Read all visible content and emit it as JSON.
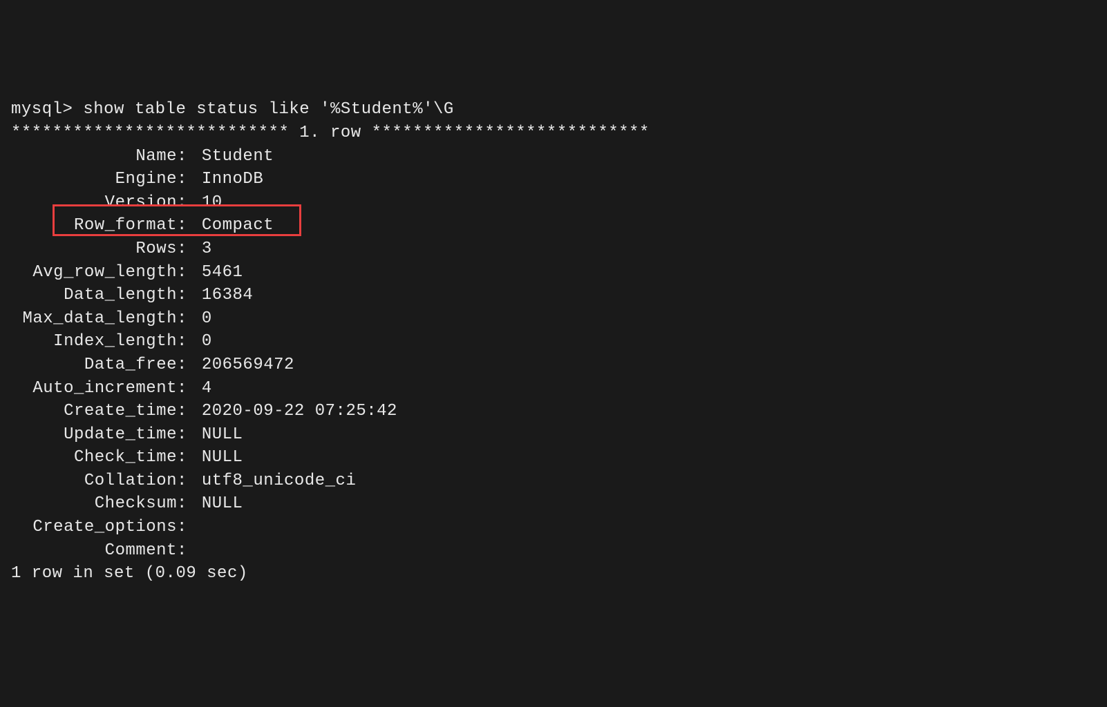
{
  "prompt": "mysql> ",
  "command": "show table status like '%Student%'\\G",
  "header": "*************************** 1. row ***************************",
  "fields": [
    {
      "key": "Name",
      "value": "Student"
    },
    {
      "key": "Engine",
      "value": "InnoDB"
    },
    {
      "key": "Version",
      "value": "10"
    },
    {
      "key": "Row_format",
      "value": "Compact"
    },
    {
      "key": "Rows",
      "value": "3"
    },
    {
      "key": "Avg_row_length",
      "value": "5461"
    },
    {
      "key": "Data_length",
      "value": "16384"
    },
    {
      "key": "Max_data_length",
      "value": "0"
    },
    {
      "key": "Index_length",
      "value": "0"
    },
    {
      "key": "Data_free",
      "value": "206569472"
    },
    {
      "key": "Auto_increment",
      "value": "4"
    },
    {
      "key": "Create_time",
      "value": "2020-09-22 07:25:42"
    },
    {
      "key": "Update_time",
      "value": "NULL"
    },
    {
      "key": "Check_time",
      "value": "NULL"
    },
    {
      "key": "Collation",
      "value": "utf8_unicode_ci"
    },
    {
      "key": "Checksum",
      "value": "NULL"
    },
    {
      "key": "Create_options",
      "value": ""
    },
    {
      "key": "Comment",
      "value": ""
    }
  ],
  "footer": "1 row in set (0.09 sec)"
}
